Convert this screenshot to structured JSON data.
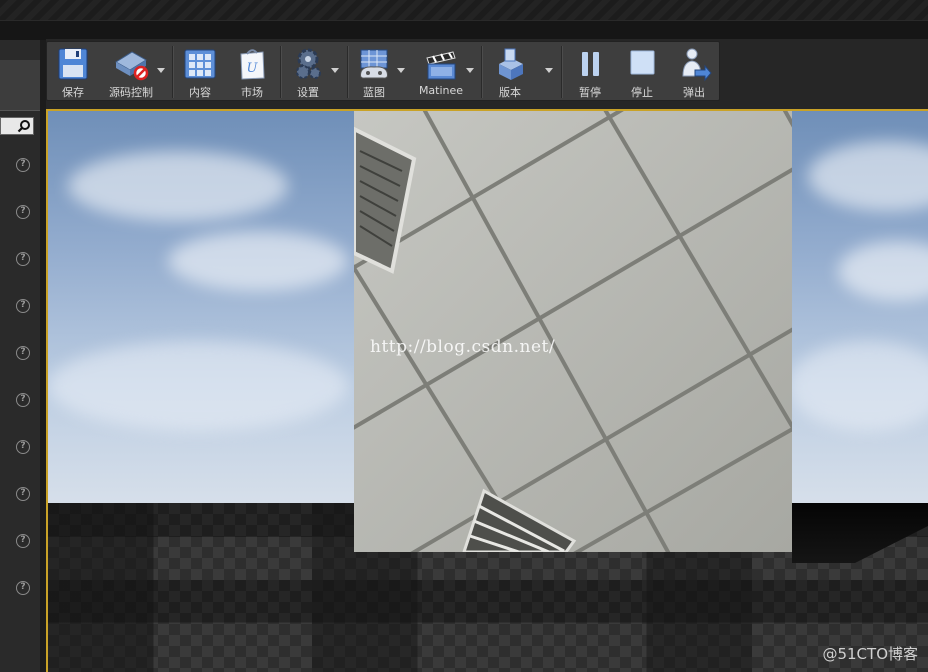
{
  "toolbar": {
    "buttons": [
      {
        "label": "保存",
        "icon": "save-icon"
      },
      {
        "label": "源码控制",
        "icon": "source-control-icon"
      },
      {
        "label": "内容",
        "icon": "content-icon"
      },
      {
        "label": "市场",
        "icon": "marketplace-icon"
      },
      {
        "label": "设置",
        "icon": "settings-icon"
      },
      {
        "label": "蓝图",
        "icon": "blueprint-icon"
      },
      {
        "label": "Matinee",
        "icon": "matinee-icon"
      },
      {
        "label": "版本",
        "icon": "build-icon"
      },
      {
        "label": "暂停",
        "icon": "pause-icon"
      },
      {
        "label": "停止",
        "icon": "stop-icon"
      },
      {
        "label": "弹出",
        "icon": "eject-icon"
      }
    ]
  },
  "left_panel": {
    "help_glyph": "?",
    "help_count": 10
  },
  "viewport": {
    "watermark_url": "http://blog.csdn.net/",
    "accent_border": "#c9a227"
  },
  "corner_watermark": "@51CTO博客"
}
